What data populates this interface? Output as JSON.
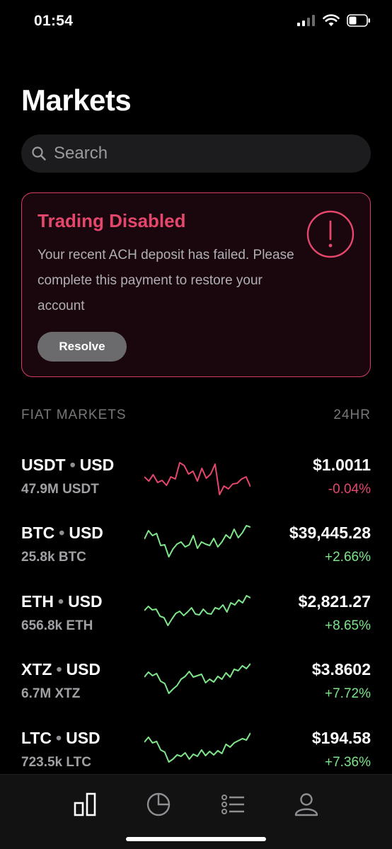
{
  "status_bar": {
    "time": "01:54"
  },
  "header": {
    "title": "Markets"
  },
  "search": {
    "placeholder": "Search"
  },
  "alert": {
    "title": "Trading Disabled",
    "body": "Your recent ACH deposit has failed. Please complete this payment to restore your account",
    "button_label": "Resolve"
  },
  "section": {
    "label": "FIAT MARKETS",
    "period": "24HR"
  },
  "markets": [
    {
      "base": "USDT",
      "quote": "USD",
      "volume": "47.9M USDT",
      "price": "$1.0011",
      "change": "-0.04%",
      "trend": "down",
      "sparkline": [
        30,
        36,
        27,
        38,
        35,
        42,
        30,
        33,
        10,
        14,
        26,
        22,
        36,
        18,
        32,
        26,
        12,
        55,
        43,
        47,
        40,
        39,
        33,
        30,
        44
      ]
    },
    {
      "base": "BTC",
      "quote": "USD",
      "volume": "25.8k BTC",
      "price": "$39,445.28",
      "change": "+2.66%",
      "trend": "up",
      "sparkline": [
        22,
        10,
        17,
        14,
        31,
        30,
        47,
        36,
        29,
        26,
        33,
        30,
        17,
        35,
        26,
        29,
        31,
        21,
        33,
        26,
        16,
        21,
        8,
        20,
        13,
        3,
        5
      ]
    },
    {
      "base": "ETH",
      "quote": "USD",
      "volume": "656.8k ETH",
      "price": "$2,821.27",
      "change": "+8.65%",
      "trend": "up",
      "sparkline": [
        26,
        20,
        25,
        24,
        34,
        36,
        47,
        38,
        30,
        27,
        33,
        28,
        22,
        31,
        32,
        24,
        30,
        31,
        22,
        24,
        18,
        28,
        15,
        18,
        11,
        15,
        5,
        8
      ]
    },
    {
      "base": "XTZ",
      "quote": "USD",
      "volume": "6.7M XTZ",
      "price": "$3.8602",
      "change": "+7.72%",
      "trend": "up",
      "sparkline": [
        24,
        17,
        22,
        19,
        30,
        33,
        47,
        41,
        36,
        27,
        23,
        16,
        24,
        22,
        20,
        32,
        27,
        31,
        23,
        27,
        18,
        24,
        13,
        15,
        8,
        12,
        5
      ]
    },
    {
      "base": "LTC",
      "quote": "USD",
      "volume": "723.5k LTC",
      "price": "$194.58",
      "change": "+7.36%",
      "trend": "up",
      "sparkline": [
        19,
        12,
        20,
        18,
        30,
        33,
        47,
        43,
        37,
        39,
        34,
        43,
        36,
        39,
        30,
        38,
        32,
        37,
        31,
        35,
        22,
        26,
        20,
        17,
        14,
        16,
        6
      ]
    }
  ],
  "tabs": [
    {
      "icon": "bar-chart-icon"
    },
    {
      "icon": "pie-chart-icon"
    },
    {
      "icon": "list-icon"
    },
    {
      "icon": "profile-icon"
    }
  ],
  "colors": {
    "negative": "#e5476c",
    "positive": "#7ee58a",
    "alert_border": "#d83e63"
  }
}
